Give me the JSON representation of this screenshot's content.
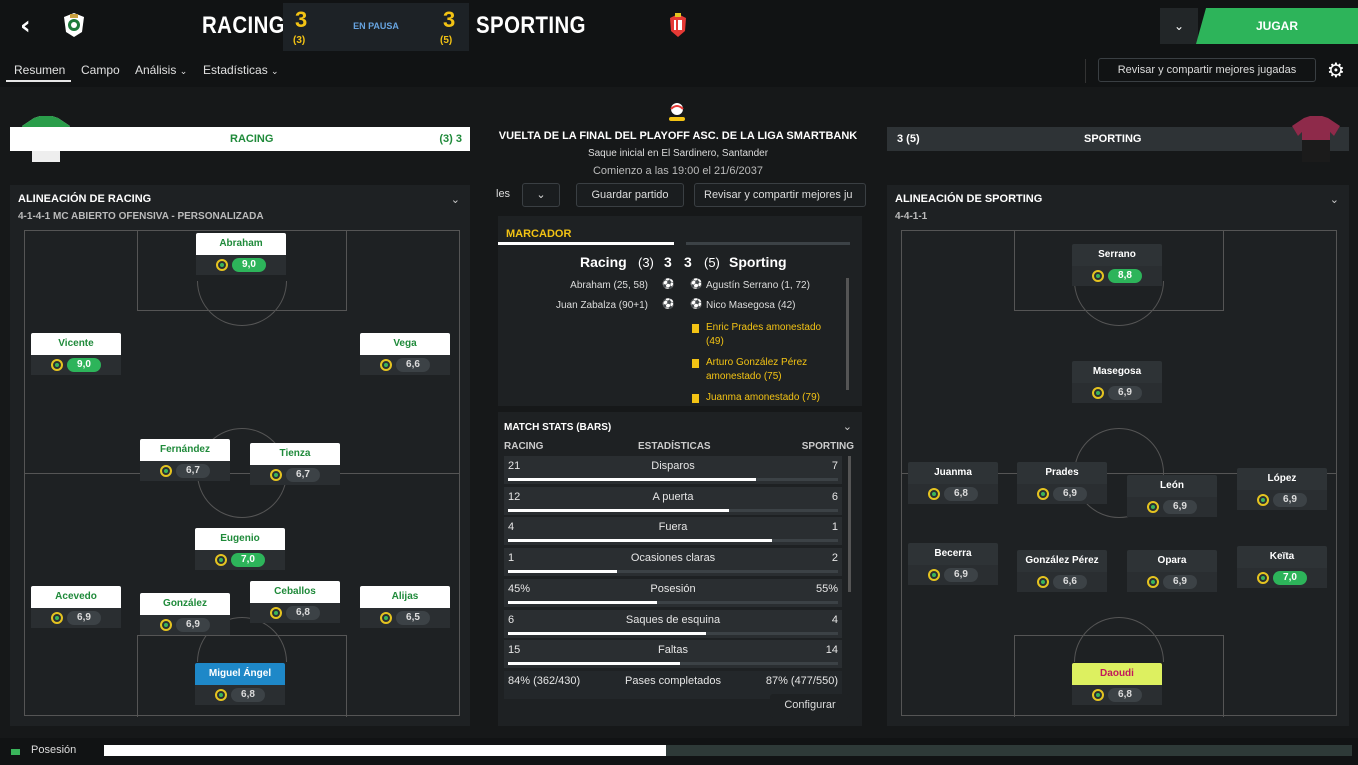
{
  "header": {
    "home_team": "RACING",
    "away_team": "SPORTING",
    "home_score": "3",
    "home_pens": "(3)",
    "away_score": "3",
    "away_pens": "(5)",
    "status": "EN PAUSA",
    "play_label": "JUGAR"
  },
  "nav": {
    "items": [
      "Resumen",
      "Campo",
      "Análisis",
      "Estadísticas"
    ],
    "share_label": "Revisar y compartir mejores jugadas"
  },
  "home_panel": {
    "team": "RACING",
    "score": "(3) 3",
    "lineup_title": "ALINEACIÓN DE RACING",
    "formation": "4-1-4-1 MC ABIERTO OFENSIVA - PERSONALIZADA",
    "players": [
      {
        "name": "Abraham",
        "rating": "9,0",
        "high": true
      },
      {
        "name": "Vicente",
        "rating": "9,0",
        "high": true
      },
      {
        "name": "Vega",
        "rating": "6,6",
        "high": false
      },
      {
        "name": "Fernández",
        "rating": "6,7",
        "high": false
      },
      {
        "name": "Tienza",
        "rating": "6,7",
        "high": false
      },
      {
        "name": "Eugenio",
        "rating": "7,0",
        "high": true
      },
      {
        "name": "Acevedo",
        "rating": "6,9",
        "high": false
      },
      {
        "name": "González",
        "rating": "6,9",
        "high": false
      },
      {
        "name": "Ceballos",
        "rating": "6,8",
        "high": false
      },
      {
        "name": "Alijas",
        "rating": "6,5",
        "high": false
      },
      {
        "name": "Miguel Ángel",
        "rating": "6,8",
        "high": false
      }
    ]
  },
  "away_panel": {
    "team": "SPORTING",
    "score": "3 (5)",
    "lineup_title": "ALINEACIÓN DE SPORTING",
    "formation": "4-4-1-1",
    "players": [
      {
        "name": "Serrano",
        "rating": "8,8",
        "high": true
      },
      {
        "name": "Masegosa",
        "rating": "6,9",
        "high": false
      },
      {
        "name": "Juanma",
        "rating": "6,8",
        "high": false
      },
      {
        "name": "Prades",
        "rating": "6,9",
        "high": false
      },
      {
        "name": "León",
        "rating": "6,9",
        "high": false
      },
      {
        "name": "López",
        "rating": "6,9",
        "high": false
      },
      {
        "name": "Becerra",
        "rating": "6,9",
        "high": false
      },
      {
        "name": "González Pérez",
        "rating": "6,6",
        "high": false
      },
      {
        "name": "Opara",
        "rating": "6,9",
        "high": false
      },
      {
        "name": "Keïta",
        "rating": "7,0",
        "high": true
      },
      {
        "name": "Daoudi",
        "rating": "6,8",
        "high": false
      }
    ]
  },
  "match_info": {
    "competition": "VUELTA DE LA FINAL DEL PLAYOFF ASC. DE LA LIGA SMARTBANK",
    "kickoff": "Saque inicial en El Sardinero, Santander",
    "start": "Comienzo a las 19:00 el 21/6/2037",
    "dd_label": "les",
    "save_label": "Guardar partido",
    "share_label": "Revisar y compartir mejores ju"
  },
  "scoreboard": {
    "title": "MARCADOR",
    "home": "Racing",
    "home_pens": "(3)",
    "home_score": "3",
    "away_score": "3",
    "away_pens": "(5)",
    "away": "Sporting",
    "home_events": [
      "Abraham (25, 58)",
      "Juan Zabalza (90+1)"
    ],
    "away_events": [
      "Agustín Serrano (1, 72)",
      "Nico Masegosa (42)"
    ],
    "cards": [
      "Enric Prades amonestado",
      "(49)",
      "Arturo González Pérez",
      "amonestado (75)",
      "Juanma amonestado (79)"
    ]
  },
  "stats": {
    "title": "MATCH STATS (BARS)",
    "col_home": "RACING",
    "col_mid": "ESTADÍSTICAS",
    "col_away": "SPORTING",
    "rows": [
      {
        "l": "21",
        "n": "Disparos",
        "r": "7",
        "frac": 0.75
      },
      {
        "l": "12",
        "n": "A puerta",
        "r": "6",
        "frac": 0.67
      },
      {
        "l": "4",
        "n": "Fuera",
        "r": "1",
        "frac": 0.8
      },
      {
        "l": "1",
        "n": "Ocasiones claras",
        "r": "2",
        "frac": 0.33
      },
      {
        "l": "45%",
        "n": "Posesión",
        "r": "55%",
        "frac": 0.45
      },
      {
        "l": "6",
        "n": "Saques de esquina",
        "r": "4",
        "frac": 0.6
      },
      {
        "l": "15",
        "n": "Faltas",
        "r": "14",
        "frac": 0.52
      },
      {
        "l": "84% (362/430)",
        "n": "Pases completados",
        "r": "87% (477/550)",
        "frac": null
      }
    ],
    "configure_label": "Configurar"
  },
  "bottom": {
    "label": "Posesión",
    "home_possession": 0.45
  }
}
